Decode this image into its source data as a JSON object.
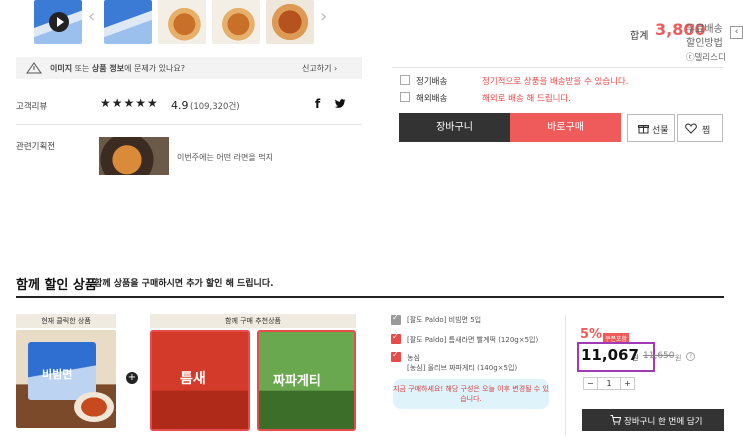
{
  "gallery": {
    "prev_arrow": "‹",
    "next_arrow": "›"
  },
  "notice": {
    "text_pre": "이미지",
    "text_mid": " 또는 ",
    "text_bold": "상품 정보",
    "text_post": "에 문제가 있나요?",
    "report": "신고하기 ›"
  },
  "review": {
    "label": "고객리뷰",
    "stars": "★★★★★",
    "rating": "4.9",
    "count": "(109,320건)"
  },
  "related": {
    "label": "관련기획전",
    "text": "이번주에는 어떤 라면을 먹지"
  },
  "total": {
    "label": "합계",
    "amount": "3,800"
  },
  "side_labels": {
    "delivery": "무료배송",
    "discount": "할인방법",
    "brand": "ⓒ델리스디"
  },
  "shipping": [
    {
      "label": "정기배송",
      "desc": "정기적으로 상품을 배송받을 수 있습니다."
    },
    {
      "label": "해외배송",
      "desc": "해외로 배송 해 드립니다."
    }
  ],
  "actions": {
    "cart": "장바구니",
    "buy": "바로구매",
    "gift": "선물",
    "wish": "찜"
  },
  "bundle": {
    "title": "함께 할인 상품",
    "subtitle": "함께 상품을 구매하시면 추가 할인 해 드립니다.",
    "current_head": "현재 클릭한 상품",
    "recommend_head": "함께 구매 추천상품",
    "plus": "+",
    "options": [
      {
        "line1": "[팔도 Paldo] 비빔면 5입",
        "line2": ""
      },
      {
        "line1": "[팔도 Paldo] 틈새라면 빨계떡 (120g×5입)",
        "line2": ""
      },
      {
        "line1": "농심",
        "line2": "[농심] 올리브 짜파게티 (140g×5입)"
      }
    ],
    "tip": "지금 구매하세요! 해당 구성은 오늘 이후 변경될 수 있습니다.",
    "discount_pct": "5%",
    "badge": "쿠폰포함",
    "price": "11,067",
    "won": "원",
    "old_price": "11,650",
    "old_won": "원",
    "qty_minus": "−",
    "qty_value": "1",
    "qty_plus": "+",
    "cart_all": "장바구니 한 번에 담기",
    "pkg_texts": [
      "비빔면",
      "틈새",
      "짜파게티"
    ]
  },
  "colors": {
    "accent": "#ef5b5b",
    "dark": "#333333",
    "highlight": "#a23ab8"
  },
  "icons": [
    "play-icon",
    "warning-icon",
    "facebook-icon",
    "twitter-icon",
    "gift-icon",
    "heart-icon",
    "cart-icon",
    "help-icon"
  ]
}
